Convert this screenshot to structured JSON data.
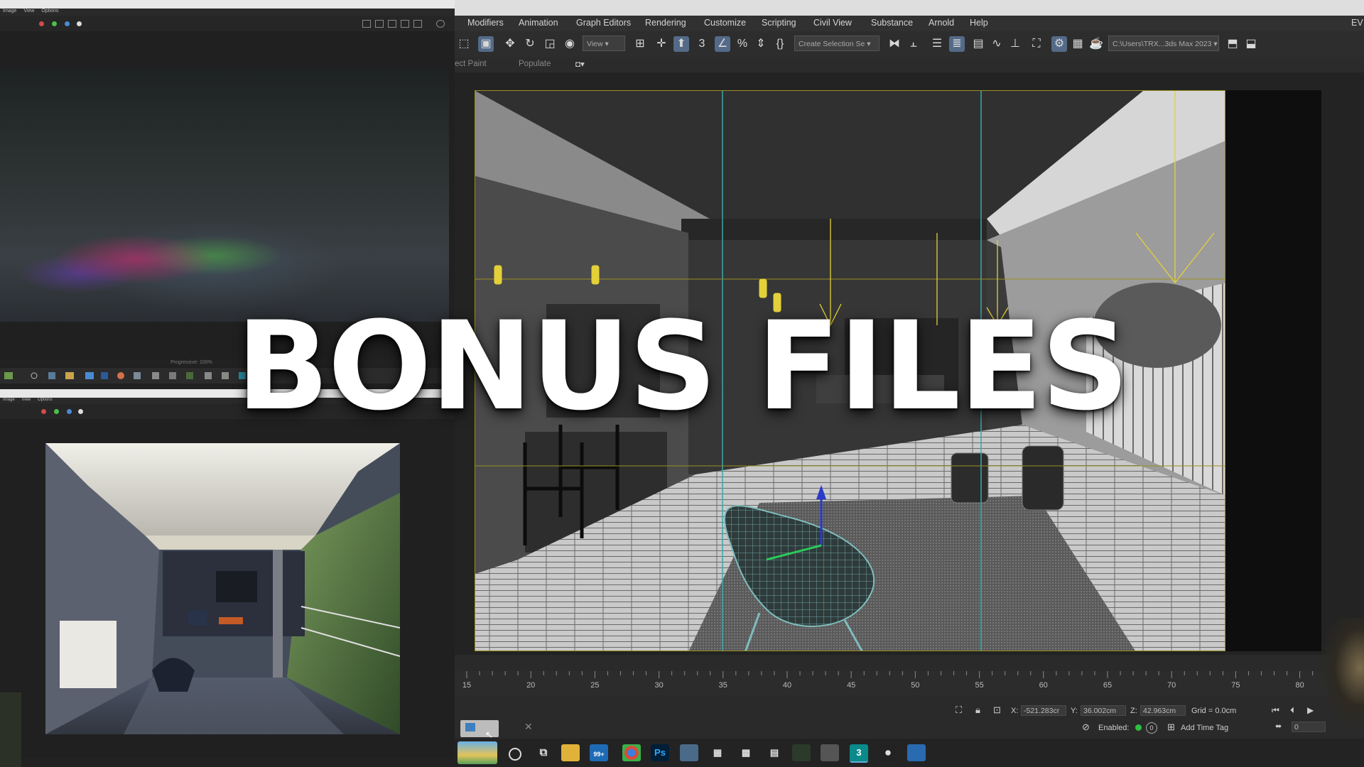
{
  "overlay": {
    "headline": "BONUS FILES"
  },
  "vfb_top": {
    "menu": [
      "Image",
      "View",
      "Options"
    ],
    "status_text": "Progressive: 100%"
  },
  "vfb_bottom": {
    "menu": [
      "Image",
      "View",
      "Options"
    ]
  },
  "max": {
    "menu": [
      "Modifiers",
      "Animation",
      "Graph Editors",
      "Rendering",
      "Customize",
      "Scripting",
      "Civil View",
      "Substance",
      "Arnold",
      "Help"
    ],
    "menu_overflow": "EV",
    "toolbar": {
      "view_dropdown": "View",
      "selection_set_dropdown": "Create Selection Se",
      "project_path": "C:\\Users\\TRX...3ds Max 2023"
    },
    "ribbon": {
      "object_paint": "ect Paint",
      "populate": "Populate"
    },
    "timeline": {
      "ticks": [
        "15",
        "20",
        "25",
        "30",
        "35",
        "40",
        "45",
        "50",
        "55",
        "60",
        "65",
        "70",
        "75",
        "80"
      ]
    },
    "status": {
      "x_label": "X:",
      "x_value": "-521.283cr",
      "y_label": "Y:",
      "y_value": "36.002cm",
      "z_label": "Z:",
      "z_value": "42.963cm",
      "grid": "Grid = 0.0cm",
      "enabled_label": "Enabled:",
      "add_time_tag": "Add Time Tag",
      "frame_value": "0"
    }
  },
  "taskbar": {
    "mail_badge": "99+",
    "ps_label": "Ps",
    "max_label": "3"
  },
  "colors": {
    "viewport_border": "#9a8f22",
    "accent_active": "#546a88",
    "light_gizmo": "#e4d13a",
    "camera_line": "#3aa8a8"
  }
}
